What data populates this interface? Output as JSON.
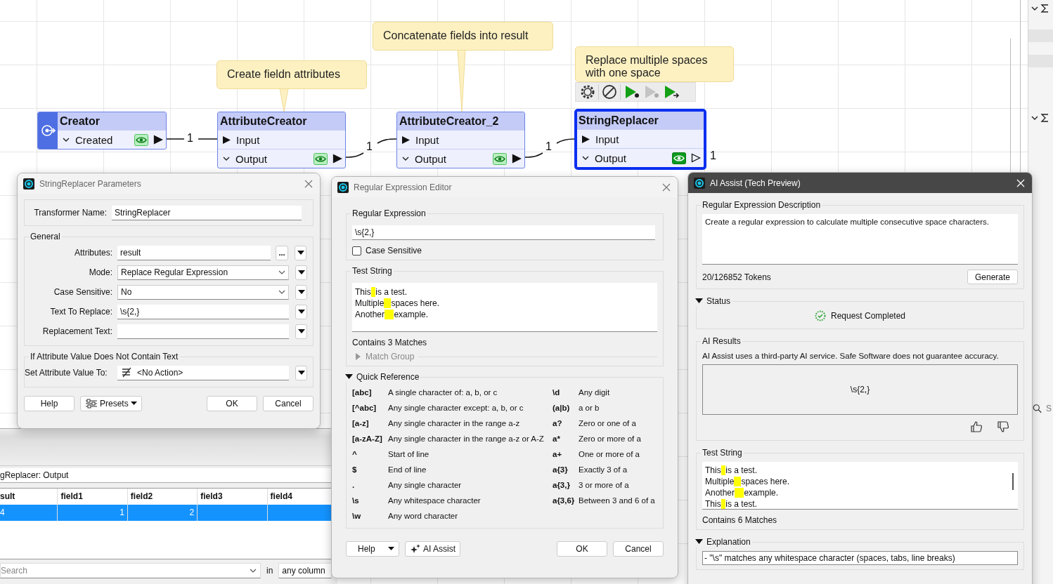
{
  "canvas": {
    "annotations": [
      {
        "text": "Create fieldn attributes"
      },
      {
        "text": "Concatenate fields into result"
      },
      {
        "text": "Replace multiple spaces with one space"
      }
    ],
    "nodes": [
      {
        "title": "Creator",
        "kind": "creator",
        "selected": false,
        "ports": [
          {
            "kind": "output",
            "label": "Created",
            "count": "1"
          }
        ]
      },
      {
        "title": "AttributeCreator",
        "kind": "transformer",
        "selected": false,
        "ports": [
          {
            "kind": "input",
            "label": "Input"
          },
          {
            "kind": "output",
            "label": "Output",
            "count": "1"
          }
        ]
      },
      {
        "title": "AttributeCreator_2",
        "kind": "transformer",
        "selected": false,
        "ports": [
          {
            "kind": "input",
            "label": "Input"
          },
          {
            "kind": "output",
            "label": "Output",
            "count": "1"
          }
        ]
      },
      {
        "title": "StringReplacer",
        "kind": "transformer",
        "selected": true,
        "ports": [
          {
            "kind": "input",
            "label": "Input"
          },
          {
            "kind": "output",
            "label": "Output",
            "count": "1"
          }
        ]
      }
    ]
  },
  "output_panel": {
    "title": "gReplacer: Output",
    "columns": [
      "sult",
      "field1",
      "field2",
      "field3",
      "field4"
    ],
    "rows": [
      {
        "selected": true,
        "cells": [
          "4",
          "1",
          "2"
        ]
      }
    ],
    "search": {
      "placeholder": "Search",
      "scope_label": "in",
      "scope": "any column"
    }
  },
  "side_panel": {
    "search": {
      "placeholder": "S"
    }
  },
  "parameters_dialog": {
    "title": "StringReplacer Parameters",
    "name_field": {
      "label": "Transformer Name:",
      "value": "StringReplacer"
    },
    "general": {
      "title": "General",
      "fields": [
        {
          "kind": "browse",
          "label": "Attributes:",
          "value": "result",
          "browse": "..."
        },
        {
          "kind": "select",
          "label": "Mode:",
          "value": "Replace Regular Expression"
        },
        {
          "kind": "select",
          "label": "Case Sensitive:",
          "value": "No"
        },
        {
          "kind": "text",
          "label": "Text To Replace:",
          "value": "\\s{2,}"
        },
        {
          "kind": "text",
          "label": "Replacement Text:"
        }
      ]
    },
    "missing": {
      "title": "If Attribute Value Does Not Contain Text",
      "fields": [
        {
          "kind": "action",
          "label": "Set Attribute Value To:",
          "value": "<No Action>"
        }
      ]
    },
    "buttons": [
      {
        "kind": "plain",
        "label": "Help"
      },
      {
        "kind": "presets",
        "label": "Presets"
      },
      {
        "kind": "plain",
        "label": "OK"
      },
      {
        "kind": "plain",
        "label": "Cancel"
      }
    ]
  },
  "regex_editor": {
    "title": "Regular Expression Editor",
    "expression": {
      "title": "Regular Expression",
      "value": "\\s{2,}",
      "case_sensitive": {
        "label": "Case Sensitive",
        "checked": false
      }
    },
    "test_string": {
      "title": "Test String",
      "lines": [
        "This  is a test.",
        "Multiple   spaces here.",
        "Another    example."
      ],
      "matches": "Contains 3 Matches",
      "match_group": {
        "label": "Match Group",
        "expanded": false
      }
    },
    "quick_reference": {
      "title": "Quick Reference",
      "expanded": true,
      "left": [
        {
          "token": "[abc]",
          "meaning": "A single character of: a, b, or c"
        },
        {
          "token": "[^abc]",
          "meaning": "Any single character except: a, b, or c"
        },
        {
          "token": "[a-z]",
          "meaning": "Any single character in the range a-z"
        },
        {
          "token": "[a-zA-Z]",
          "meaning": "Any single character in the range a-z or A-Z"
        },
        {
          "token": "^",
          "meaning": "Start of line"
        },
        {
          "token": "$",
          "meaning": "End of line"
        },
        {
          "token": ".",
          "meaning": "Any single character"
        },
        {
          "token": "\\s",
          "meaning": "Any whitespace character"
        },
        {
          "token": "\\w",
          "meaning": "Any word character"
        }
      ],
      "right": [
        {
          "token": "\\d",
          "meaning": "Any digit"
        },
        {
          "token": "(a|b)",
          "meaning": "a or b"
        },
        {
          "token": "a?",
          "meaning": "Zero or one of a"
        },
        {
          "token": "a*",
          "meaning": "Zero or more of a"
        },
        {
          "token": "a+",
          "meaning": "One or more of a"
        },
        {
          "token": "a{3}",
          "meaning": "Exactly 3 of a"
        },
        {
          "token": "a{3,}",
          "meaning": "3 or more of a"
        },
        {
          "token": "a{3,6}",
          "meaning": "Between 3 and 6 of a"
        }
      ]
    },
    "buttons": [
      {
        "kind": "menu",
        "label": "Help"
      },
      {
        "kind": "ai",
        "label": "AI Assist"
      },
      {
        "kind": "plain",
        "label": "OK"
      },
      {
        "kind": "plain",
        "label": "Cancel"
      }
    ]
  },
  "ai_assist": {
    "title": "AI Assist (Tech Preview)",
    "description": {
      "title": "Regular Expression Description",
      "value": "Create a regular expression to calculate multiple consecutive space characters.",
      "tokens": "20/126852 Tokens",
      "button": "Generate"
    },
    "status": {
      "title": "Status",
      "expanded": true,
      "message": "Request Completed"
    },
    "results": {
      "title": "AI Results",
      "disclaimer": "AI Assist uses a third-party AI service. Safe Software does not guarantee accuracy.",
      "expression": "\\s{2,}"
    },
    "test_string": {
      "title": "Test String",
      "lines": [
        "This  is a test.",
        "Multiple   spaces here.",
        "Another    example.",
        "This  is a test."
      ],
      "matches": "Contains 6 Matches"
    },
    "explanation": {
      "title": "Explanation",
      "expanded": true,
      "lines": [
        "- \"\\s\" matches any whitespace character (spaces, tabs, line breaks)"
      ]
    }
  }
}
